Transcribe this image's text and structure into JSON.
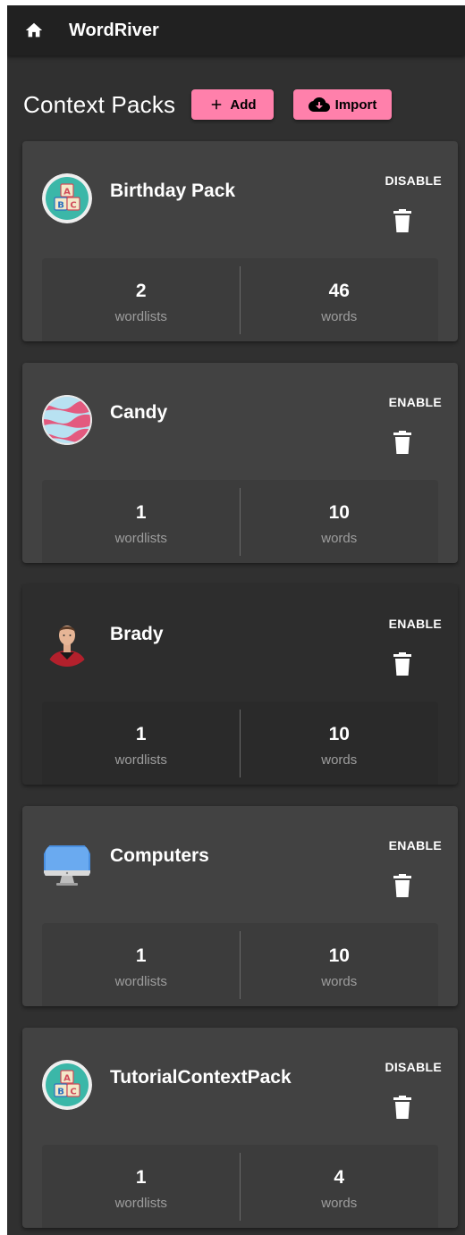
{
  "app": {
    "title": "WordRiver"
  },
  "page": {
    "title": "Context Packs",
    "add_label": "Add",
    "import_label": "Import"
  },
  "colors": {
    "accent": "#ff80ab",
    "surface": "#424242",
    "background": "#303030",
    "appbar": "#212121"
  },
  "packs": [
    {
      "name": "Birthday Pack",
      "toggle": "DISABLE",
      "wordlists": "2",
      "wordlists_label": "wordlists",
      "words": "46",
      "words_label": "words",
      "icon": "abc-blocks-icon"
    },
    {
      "name": "Candy",
      "toggle": "ENABLE",
      "wordlists": "1",
      "wordlists_label": "wordlists",
      "words": "10",
      "words_label": "words",
      "icon": "candy-icon"
    },
    {
      "name": "Brady",
      "toggle": "ENABLE",
      "wordlists": "1",
      "wordlists_label": "wordlists",
      "words": "10",
      "words_label": "words",
      "icon": "person-photo-icon"
    },
    {
      "name": "Computers",
      "toggle": "ENABLE",
      "wordlists": "1",
      "wordlists_label": "wordlists",
      "words": "10",
      "words_label": "words",
      "icon": "monitor-icon"
    },
    {
      "name": "TutorialContextPack",
      "toggle": "DISABLE",
      "wordlists": "1",
      "wordlists_label": "wordlists",
      "words": "4",
      "words_label": "words",
      "icon": "abc-blocks-icon"
    }
  ]
}
